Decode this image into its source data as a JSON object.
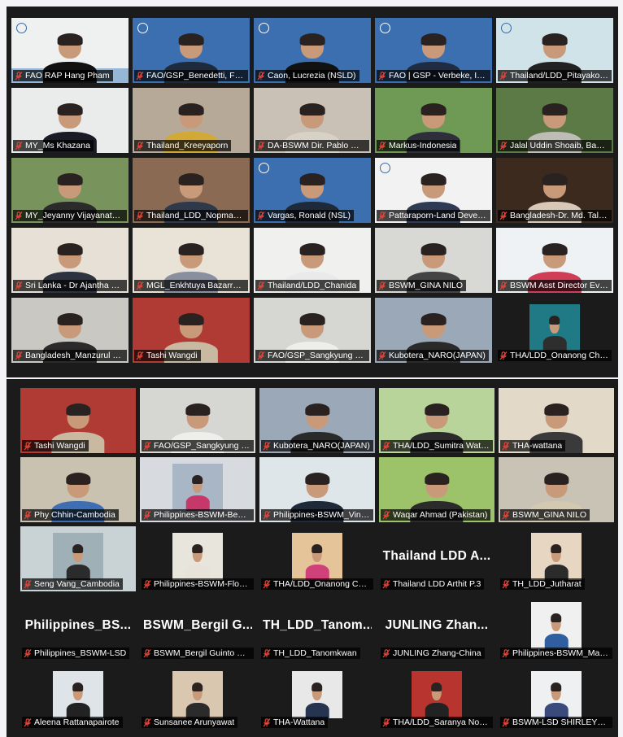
{
  "meeting": {
    "top_grid": [
      {
        "label": "FAO RAP Hang Pham",
        "bg": "#eef1f0",
        "accent": "#4b86c4",
        "shirt": "#111111",
        "logo": "FAO"
      },
      {
        "label": "FAO/GSP_Benedetti, Filippo (...",
        "bg": "#3c6fb0",
        "shirt": "#1d2b3d",
        "logo": "Food and Agriculture Organization of the United Nations",
        "active": true
      },
      {
        "label": "Caon, Lucrezia (NSLD)",
        "bg": "#3c6fb0",
        "shirt": "#111111",
        "logo": "Food and Agriculture Organization of the United Nations"
      },
      {
        "label": "FAO | GSP - Verbeke, Isab...",
        "bg": "#3c6fb0",
        "shirt": "#1f2c44",
        "logo": "Food and Agriculture Organization of the United Nations"
      },
      {
        "label": "Thailand/LDD_Pitayakon...",
        "bg": "#cfe3e8",
        "shirt": "#222222",
        "logo": "Land Development Department (LDD)"
      },
      {
        "label": "MY_Ms Khazana",
        "bg": "#e9eceb",
        "shirt": "#1b1b25",
        "logo": ""
      },
      {
        "label": "Thailand_Kreeyaporn",
        "bg": "#b7a998",
        "shirt": "#d3a936",
        "logo": ""
      },
      {
        "label": "DA-BSWM Dir. Pablo M. ...",
        "bg": "#c9c1b5",
        "shirt": "#d8d2c6",
        "logo": ""
      },
      {
        "label": "Markus-Indonesia",
        "bg": "#6f9a56",
        "shirt": "#2e2f3b",
        "logo": ""
      },
      {
        "label": "Jalal Uddin Shoaib, Bangl...",
        "bg": "#5c7a45",
        "shirt": "#bdbdb5",
        "logo": ""
      },
      {
        "label": "MY_Jeyanny Vijayanathan",
        "bg": "#78935c",
        "shirt": "#2b2b2b",
        "logo": ""
      },
      {
        "label": "Thailand_LDD_Nopmane...",
        "bg": "#8a6a52",
        "shirt": "#2e3a4b",
        "logo": ""
      },
      {
        "label": "Vargas, Ronald (NSL)",
        "bg": "#3c6fb0",
        "shirt": "#1e2a3a",
        "logo": "Food and Agriculture Organization of the United Nations"
      },
      {
        "label": "Pattaraporn-Land Develo...",
        "bg": "#f2f2f2",
        "shirt": "#2f3a55",
        "logo": "Land Development Department"
      },
      {
        "label": "Bangladesh-Dr. Md. Tala...",
        "bg": "#3d2a1e",
        "shirt": "#d9c8b5",
        "logo": ""
      },
      {
        "label": "Sri Lanka - Dr Ajantha de ...",
        "bg": "#e7e0d6",
        "shirt": "#2e3340",
        "logo": ""
      },
      {
        "label": "MGL_Enkhtuya Bazarradn...",
        "bg": "#e9e3d7",
        "shirt": "#8a8fa0",
        "logo": ""
      },
      {
        "label": "Thailand/LDD_Chanida",
        "bg": "#f0f0ee",
        "shirt": "#eaeaea",
        "logo": ""
      },
      {
        "label": "BSWM_GINA NILO",
        "bg": "#d8d8d5",
        "shirt": "#444444",
        "logo": ""
      },
      {
        "label": "BSWM Asst Director Evel...",
        "bg": "#eef2f5",
        "shirt": "#cf3e56",
        "logo": ""
      },
      {
        "label": "Bangladesh_Manzurul H...",
        "bg": "#cac8c3",
        "shirt": "#2b2b2b",
        "logo": ""
      },
      {
        "label": "Tashi Wangdi",
        "bg": "#b03a34",
        "shirt": "#c9b9a0",
        "logo": ""
      },
      {
        "label": "FAO/GSP_Sangkyung Lee",
        "bg": "#d6d6d3",
        "shirt": "#eeeeea",
        "logo": ""
      },
      {
        "label": "Kubotera_NARO(JAPAN)",
        "bg": "#9aa8b8",
        "shirt": "#2a2a2a",
        "logo": ""
      },
      {
        "label": "THA/LDD_Onanong Cho...",
        "bg": "#1b1b1b",
        "shirt": "#2e2e2e",
        "logo": "",
        "inset": "#1f7a86"
      }
    ],
    "bottom_grid": [
      {
        "label": "Tashi Wangdi",
        "bg": "#b03a34",
        "shirt": "#c9b9a0"
      },
      {
        "label": "FAO/GSP_Sangkyung Lee",
        "bg": "#d6d6d3",
        "shirt": "#eeeeea"
      },
      {
        "label": "Kubotera_NARO(JAPAN)",
        "bg": "#9aa8b8",
        "shirt": "#2a2a2a"
      },
      {
        "label": "THA/LDD_Sumitra Watana",
        "bg": "#b9d49a",
        "shirt": "#2b2b2b"
      },
      {
        "label": "THA-wattana",
        "bg": "#e2d9c8",
        "shirt": "#3a3a3a"
      },
      {
        "label": "Phy Chhin-Cambodia",
        "bg": "#c9c2b0",
        "shirt": "#3f6fb3"
      },
      {
        "label": "Philippines-BSWM-Beatri...",
        "bg": "#d7dbe0",
        "shirt": "#c7386a",
        "inset": "#a9b6c6"
      },
      {
        "label": "Philippines-BSWM_Vince...",
        "bg": "#dfe6ea",
        "shirt": "#1e2a3a"
      },
      {
        "label": "Waqar Ahmad (Pakistan)",
        "bg": "#9cc26a",
        "shirt": "#2b2b2b"
      },
      {
        "label": "BSWM_GINA NILO",
        "bg": "#c9c3b6",
        "shirt": "#d3c8b0"
      },
      {
        "label": "Seng Vang_Cambodia",
        "bg": "#c9d3d6",
        "shirt": "#2b2b2b",
        "inset": "#9fb0b6"
      },
      {
        "label": "Philippines-BSWM-Florfi...",
        "bg": "#1b1b1b",
        "shirt": "#e8e3da",
        "inset": "#e8e5dd"
      },
      {
        "label": "THA/LDD_Onanong Cho...",
        "bg": "#1b1b1b",
        "shirt": "#d0417a",
        "inset": "#e6c49a"
      },
      {
        "label": "Thailand LDD Arthit P.3",
        "bg": "#1b1b1b",
        "shirt": "",
        "name": "Thailand LDD A..."
      },
      {
        "label": "TH_LDD_Jutharat",
        "bg": "#1b1b1b",
        "shirt": "#2b2b2b",
        "inset": "#e7d7c2"
      },
      {
        "label": "Philippines_BSWM-LSD",
        "bg": "#1b1b1b",
        "shirt": "",
        "name": "Philippines_BS..."
      },
      {
        "label": "BSWM_Bergil Guinto Ber...",
        "bg": "#1b1b1b",
        "shirt": "",
        "name": "BSWM_Bergil G..."
      },
      {
        "label": "TH_LDD_Tanomkwan",
        "bg": "#1b1b1b",
        "shirt": "",
        "name": "TH_LDD_Tanom..."
      },
      {
        "label": "JUNLING Zhang-China",
        "bg": "#1b1b1b",
        "shirt": "",
        "name": "JUNLING Zhan..."
      },
      {
        "label": "Philippines-BSWM_Marjo...",
        "bg": "#1b1b1b",
        "shirt": "#2f5fa0",
        "inset": "#f0f0f0"
      },
      {
        "label": "Aleena Rattanapairote",
        "bg": "#1b1b1b",
        "shirt": "#222222",
        "inset": "#dfe4e8"
      },
      {
        "label": "Sunsanee Arunyawat",
        "bg": "#1b1b1b",
        "shirt": "#2b2b2b",
        "inset": "#d9c7b0"
      },
      {
        "label": "THA-Wattana",
        "bg": "#1b1b1b",
        "shirt": "#263450",
        "inset": "#e8e8e8"
      },
      {
        "label": "THA/LDD_Saranya Norka...",
        "bg": "#1b1b1b",
        "shirt": "#222222",
        "inset": "#b8342e"
      },
      {
        "label": "BSWM-LSD SHIRLEY_BU...",
        "bg": "#1b1b1b",
        "shirt": "#3a4a7a",
        "inset": "#eef0f2"
      }
    ],
    "colors": {
      "panel": "#1b1b1b",
      "active_speaker": "#c8e63c",
      "muted_icon": "#e0453a"
    }
  }
}
